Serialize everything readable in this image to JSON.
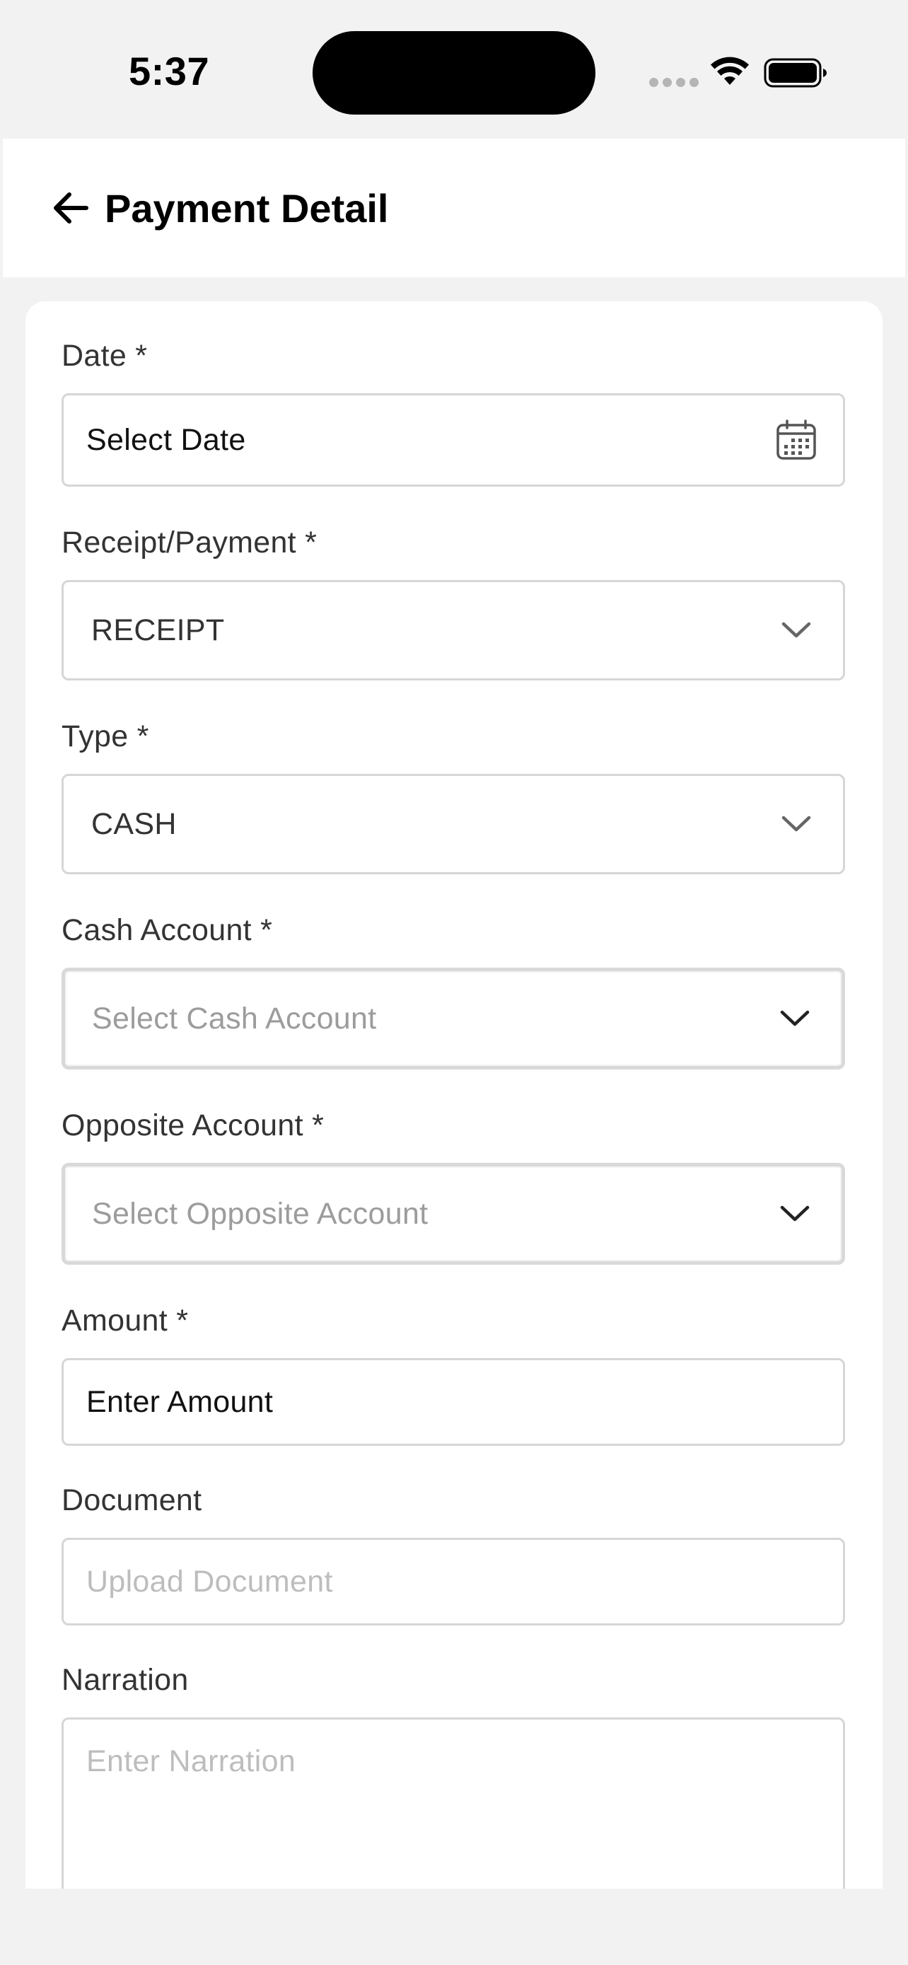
{
  "status_bar": {
    "time": "5:37"
  },
  "header": {
    "title": "Payment Detail",
    "back_icon": "arrow-left-icon"
  },
  "form": {
    "date": {
      "label": "Date *",
      "placeholder": "Select Date",
      "icon": "calendar-icon"
    },
    "receipt_payment": {
      "label": "Receipt/Payment *",
      "value": "RECEIPT",
      "icon": "chevron-down-icon"
    },
    "type": {
      "label": "Type *",
      "value": "CASH",
      "icon": "chevron-down-icon"
    },
    "cash_account": {
      "label": "Cash Account *",
      "placeholder": "Select Cash Account",
      "icon": "chevron-down-icon"
    },
    "opposite_account": {
      "label": "Opposite Account *",
      "placeholder": "Select Opposite Account",
      "icon": "chevron-down-icon"
    },
    "amount": {
      "label": "Amount *",
      "placeholder": "Enter Amount"
    },
    "document": {
      "label": "Document",
      "placeholder": "Upload Document"
    },
    "narration": {
      "label": "Narration",
      "placeholder": "Enter Narration"
    }
  },
  "colors": {
    "background": "#f2f2f2",
    "surface": "#ffffff",
    "border": "#d6d6d6",
    "label": "#333333",
    "placeholder": "#a3a3a3"
  }
}
